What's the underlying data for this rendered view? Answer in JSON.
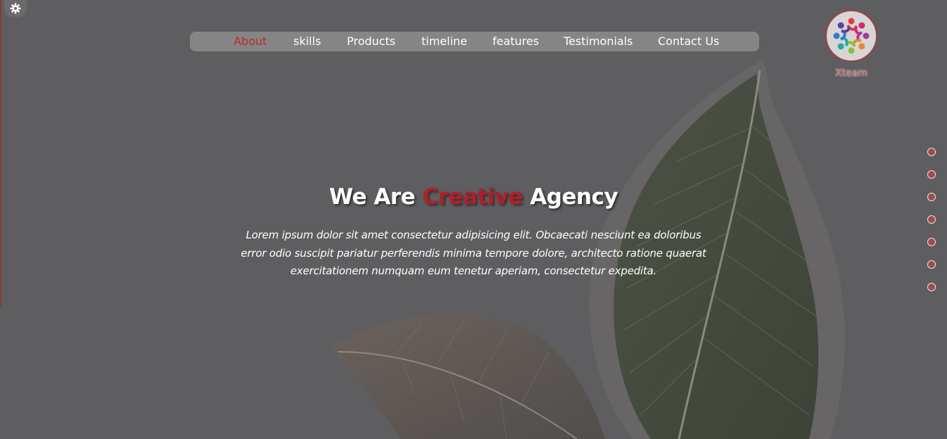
{
  "settings": {
    "icon": "gear-icon"
  },
  "nav": {
    "items": [
      {
        "label": "About",
        "active": true
      },
      {
        "label": "skills",
        "active": false
      },
      {
        "label": "Products",
        "active": false
      },
      {
        "label": "timeline",
        "active": false
      },
      {
        "label": "features",
        "active": false
      },
      {
        "label": "Testimonials",
        "active": false
      },
      {
        "label": "Contact Us",
        "active": false
      }
    ]
  },
  "logo": {
    "text": "Xteam"
  },
  "hero": {
    "title_before": "We Are",
    "title_accent": "Creative",
    "title_after": "Agency",
    "text": "Lorem ipsum dolor sit amet consectetur adipisicing elit. Obcaecati nesciunt ea doloribus error odio suscipit pariatur perferendis minima tempore dolore, architecto ratione quaerat exercitationem numquam eum tenetur aperiam, consectetur expedita."
  },
  "colors": {
    "accent": "#b01f28",
    "overlay": "#5e5e61",
    "bullet": "#a24a4e"
  },
  "bullets": {
    "count": 7
  }
}
